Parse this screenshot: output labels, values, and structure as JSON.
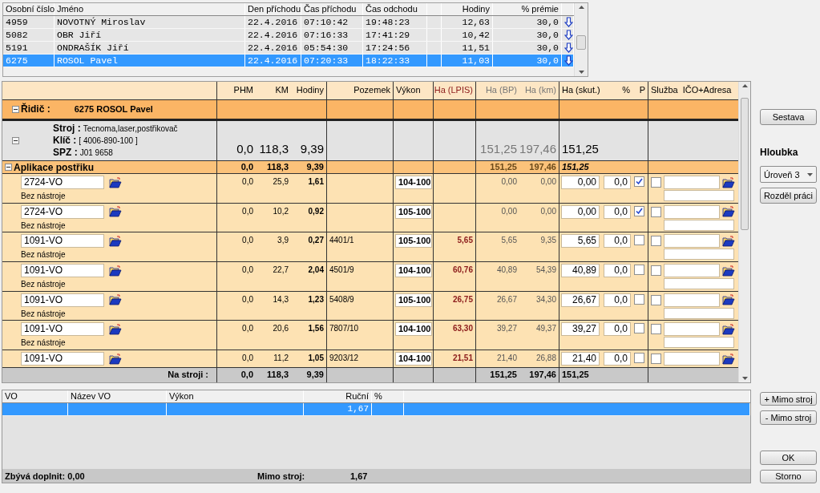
{
  "attendance": {
    "columns": [
      "Osobní číslo",
      "Jméno",
      "Den příchodu",
      "Čas příchodu",
      "Čas odchodu",
      "Hodiny",
      "% prémie"
    ],
    "rows": [
      {
        "id": "4959",
        "name": "NOVOTNÝ Miroslav",
        "date": "22.4.2016",
        "arrival": "07:10:42",
        "departure": "19:48:23",
        "hours": "12,63",
        "bonus": "30,0",
        "selected": false
      },
      {
        "id": "5082",
        "name": "OBR Jiří",
        "date": "22.4.2016",
        "arrival": "07:16:33",
        "departure": "17:41:29",
        "hours": "10,42",
        "bonus": "30,0",
        "selected": false
      },
      {
        "id": "5191",
        "name": "ONDRAŠÍK Jiří",
        "date": "22.4.2016",
        "arrival": "05:54:30",
        "departure": "17:24:56",
        "hours": "11,51",
        "bonus": "30,0",
        "selected": false
      },
      {
        "id": "6275",
        "name": "ROSOL Pavel",
        "date": "22.4.2016",
        "arrival": "07:20:33",
        "departure": "18:22:33",
        "hours": "11,03",
        "bonus": "30,0",
        "selected": true
      }
    ]
  },
  "machine_table": {
    "columns": [
      "PHM",
      "KM",
      "Hodiny",
      "Pozemek",
      "Výkon",
      "Ha (LPIS)",
      "Ha (BP)",
      "Ha (km)",
      "Ha (skut.)",
      "%",
      "P",
      "Služba",
      "IČO+Adresa"
    ],
    "driver": {
      "label": "Řidič :",
      "value": "6275 ROSOL Pavel",
      "expanded": true
    },
    "machine": {
      "expanded": true,
      "fields": [
        {
          "label": "Stroj :",
          "value": "Tecnoma,laser,postřikovač"
        },
        {
          "label": "Klíč :",
          "value": "[ 4006-890-100 ]"
        },
        {
          "label": "SPZ :",
          "value": "J01 9658"
        }
      ],
      "phm": "0,0",
      "km": "118,3",
      "hours": "9,39",
      "ha_bp": "151,25",
      "ha_km": "197,46",
      "ha_actual": "151,25"
    },
    "operation": {
      "label": "Aplikace postřiku",
      "expanded": true,
      "phm": "0,0",
      "km": "118,3",
      "hours": "9,39",
      "ha_bp": "151,25",
      "ha_km": "197,46",
      "ha_actual": "151,25"
    },
    "items": [
      {
        "vo": "2724-VO",
        "tool": "Bez nástroje",
        "phm": "0,0",
        "km": "25,9",
        "hours": "1,61",
        "vykon": "104-100",
        "ha_bp": "0,00",
        "ha_km": "0,00",
        "ha_actual": "0,00",
        "pct": "0,0",
        "p": true,
        "service": false
      },
      {
        "vo": "2724-VO",
        "tool": "Bez nástroje",
        "phm": "0,0",
        "km": "10,2",
        "hours": "0,92",
        "vykon": "105-100",
        "ha_bp": "0,00",
        "ha_km": "0,00",
        "ha_actual": "0,00",
        "pct": "0,0",
        "p": true,
        "service": false
      },
      {
        "vo": "1091-VO",
        "tool": "Bez nástroje",
        "phm": "0,0",
        "km": "3,9",
        "hours": "0,27",
        "plot": "4401/1",
        "vykon": "105-100",
        "ha_lpis": "5,65",
        "ha_bp": "5,65",
        "ha_km": "9,35",
        "ha_actual": "5,65",
        "pct": "0,0",
        "p": false,
        "service": false
      },
      {
        "vo": "1091-VO",
        "tool": "Bez nástroje",
        "phm": "0,0",
        "km": "22,7",
        "hours": "2,04",
        "plot": "4501/9",
        "vykon": "104-100",
        "ha_lpis": "60,76",
        "ha_bp": "40,89",
        "ha_km": "54,39",
        "ha_actual": "40,89",
        "pct": "0,0",
        "p": false,
        "service": false
      },
      {
        "vo": "1091-VO",
        "tool": "Bez nástroje",
        "phm": "0,0",
        "km": "14,3",
        "hours": "1,23",
        "plot": "5408/9",
        "vykon": "105-100",
        "ha_lpis": "26,75",
        "ha_bp": "26,67",
        "ha_km": "34,30",
        "ha_actual": "26,67",
        "pct": "0,0",
        "p": false,
        "service": false
      },
      {
        "vo": "1091-VO",
        "tool": "Bez nástroje",
        "phm": "0,0",
        "km": "20,6",
        "hours": "1,56",
        "plot": "7807/10",
        "vykon": "104-100",
        "ha_lpis": "63,30",
        "ha_bp": "39,27",
        "ha_km": "49,37",
        "ha_actual": "39,27",
        "pct": "0,0",
        "p": false,
        "service": false
      },
      {
        "vo": "1091-VO",
        "phm": "0,0",
        "km": "11,2",
        "hours": "1,05",
        "plot": "9203/12",
        "vykon": "104-100",
        "ha_lpis": "21,51",
        "ha_bp": "21,40",
        "ha_km": "26,88",
        "ha_actual": "21,40",
        "pct": "0,0",
        "p": false,
        "service": false
      }
    ],
    "total": {
      "label": "Na stroji :",
      "phm": "0,0",
      "km": "118,3",
      "hours": "9,39",
      "ha_bp": "151,25",
      "ha_km": "197,46",
      "ha_actual": "151,25"
    }
  },
  "side": {
    "report_button": "Sestava",
    "depth_label": "Hloubka",
    "depth_value": "Úroveň 3",
    "split_button": "Rozděl práci"
  },
  "manual_table": {
    "columns": [
      "VO",
      "Název VO",
      "Výkon",
      "Ruční",
      "%"
    ],
    "rows": [
      {
        "manual": "1,67",
        "selected": true
      }
    ],
    "remaining": "Zbývá doplnit: 0,00",
    "off_label": "Mimo stroj:",
    "off_value": "1,67"
  },
  "buttons": {
    "add_off": "+ Mimo stroj",
    "remove_off": "- Mimo stroj",
    "ok": "OK",
    "cancel": "Storno"
  }
}
